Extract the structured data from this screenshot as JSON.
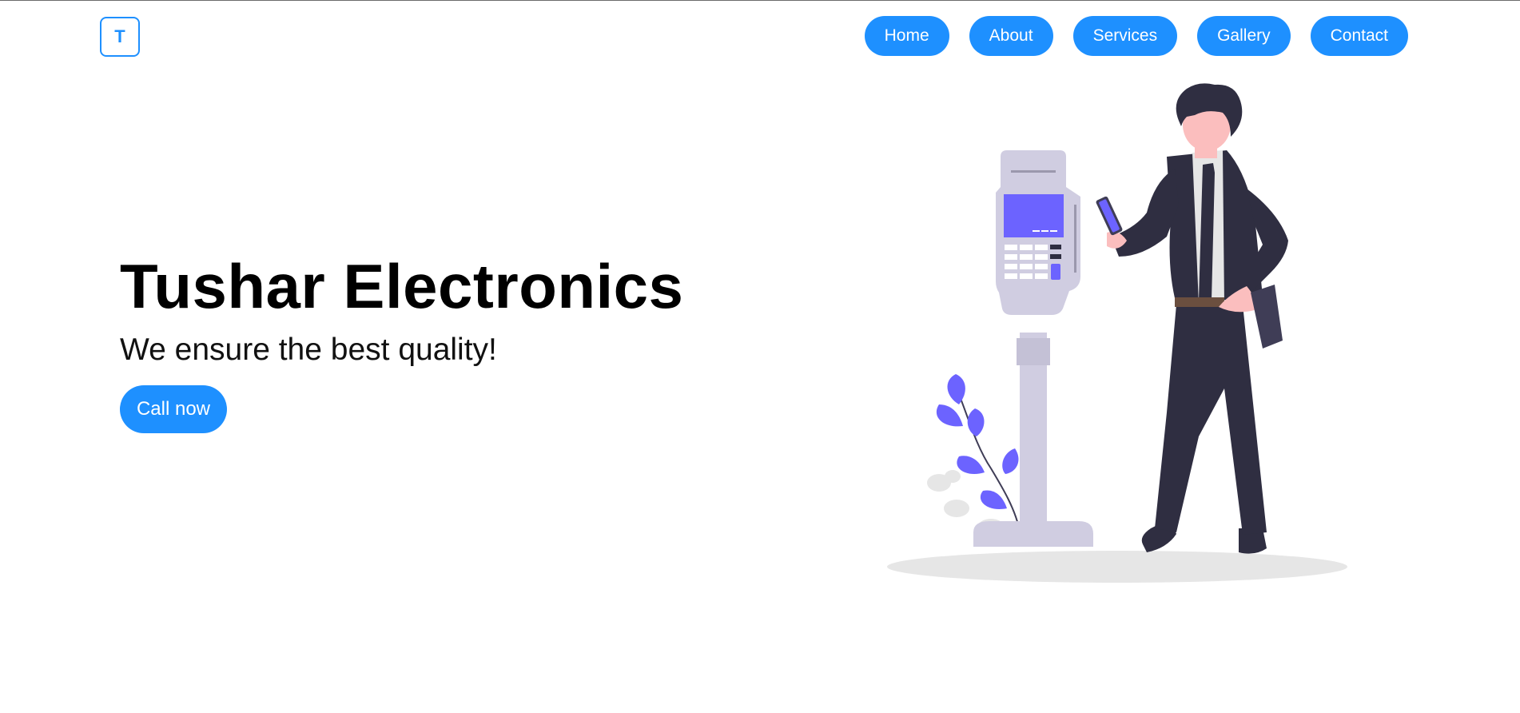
{
  "logo": {
    "letter": "T"
  },
  "nav": {
    "items": [
      {
        "label": "Home"
      },
      {
        "label": "About"
      },
      {
        "label": "Services"
      },
      {
        "label": "Gallery"
      },
      {
        "label": "Contact"
      }
    ]
  },
  "hero": {
    "title": "Tushar Electronics",
    "subtitle": "We ensure the best quality!",
    "cta_label": "Call now"
  },
  "colors": {
    "accent": "#1e90ff",
    "illustration_purple": "#6c63ff",
    "suit": "#2f2e41",
    "terminal": "#d0cde1"
  },
  "illustration": {
    "name": "man-paying-at-terminal-illustration"
  }
}
